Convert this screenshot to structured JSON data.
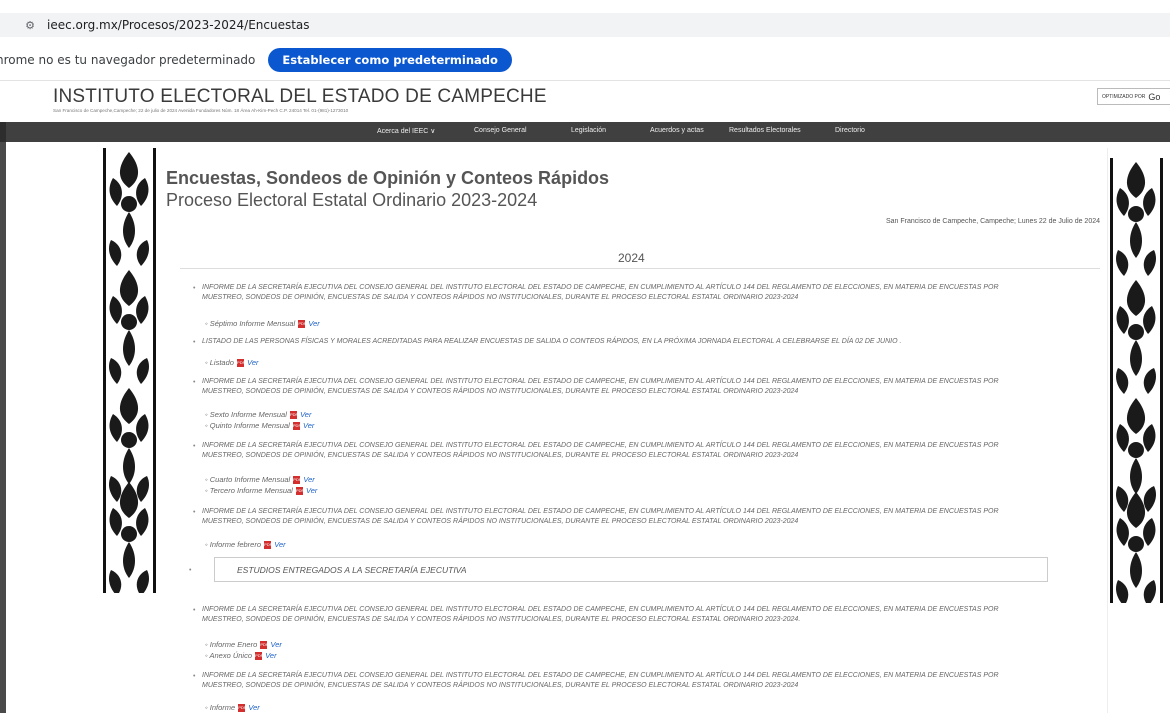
{
  "browser": {
    "url": "ieec.org.mx/Procesos/2023-2024/Encuestas",
    "infobar_text": "hrome no es tu navegador predeterminado",
    "infobar_button": "Establecer como predeterminado"
  },
  "header": {
    "title": "INSTITUTO ELECTORAL DEL ESTADO DE CAMPECHE",
    "address": "San Francisco de Campeche,Campeche; 22 de julio de 2024 Avenida Fundadores Núm. 18 Área Ah-Kim-Pech C.P. 24014 Tel. 01-(981)-1273010",
    "search_label": "OPTIMIZADO POR",
    "search_brand": "Go"
  },
  "nav": {
    "items": [
      "Acerca del IEEC ∨",
      "Consejo General",
      "Legislación",
      "Acuerdos y actas",
      "Resultados Electorales",
      "Directorio"
    ]
  },
  "page": {
    "title": "Encuestas, Sondeos de Opinión y Conteos Rápidos",
    "subtitle": "Proceso Electoral Estatal Ordinario 2023-2024",
    "date": "San Francisco de Campeche, Campeche; Lunes 22 de Julio de 2024",
    "year": "2024",
    "ver": "Ver",
    "informe_line1": "INFORME DE LA SECRETARÍA EJECUTIVA DEL CONSEJO GENERAL DEL INSTITUTO ELECTORAL DEL ESTADO DE CAMPECHE, EN CUMPLIMIENTO AL ARTÍCULO 144 DEL REGLAMENTO DE ELECCIONES, EN MATERIA DE ENCUESTAS POR",
    "informe_line2": "MUESTREO, SONDEOS DE OPINIÓN, ENCUESTAS DE SALIDA Y CONTEOS RÁPIDOS NO INSTITUCIONALES, DURANTE EL PROCESO ELECTORAL ESTATAL ORDINARIO 2023-2024",
    "informe_line2_dot": "MUESTREO, SONDEOS DE OPINIÓN, ENCUESTAS DE SALIDA Y CONTEOS RÁPIDOS NO INSTITUCIONALES, DURANTE EL PROCESO ELECTORAL ESTATAL ORDINARIO 2023-2024.",
    "listado_text": "LISTADO DE LAS PERSONAS FÍSICAS Y MORALES ACREDITADAS PARA REALIZAR ENCUESTAS DE SALIDA O CONTEOS RÁPIDOS, EN LA PRÓXIMA JORNADA ELECTORAL A CELEBRARSE EL DÍA 02 DE JUNIO .",
    "sub": {
      "septimo": "Séptimo Informe Mensual",
      "listado": "Listado",
      "sexto": "Sexto Informe Mensual",
      "quinto": "Quinto Informe Mensual",
      "cuarto": "Cuarto Informe Mensual",
      "tercero": "Tercero Informe Mensual",
      "febrero": "Informe febrero",
      "enero": "Informe Enero",
      "anexo": "Anexo Único",
      "informe": "Informe"
    },
    "studios": "ESTUDIOS ENTREGADOS A LA SECRETARÍA EJECUTIVA"
  },
  "colors": {
    "navbar": "#404040",
    "link": "#1e63c7",
    "button": "#0b57d0",
    "pdf": "#d32f2f"
  }
}
